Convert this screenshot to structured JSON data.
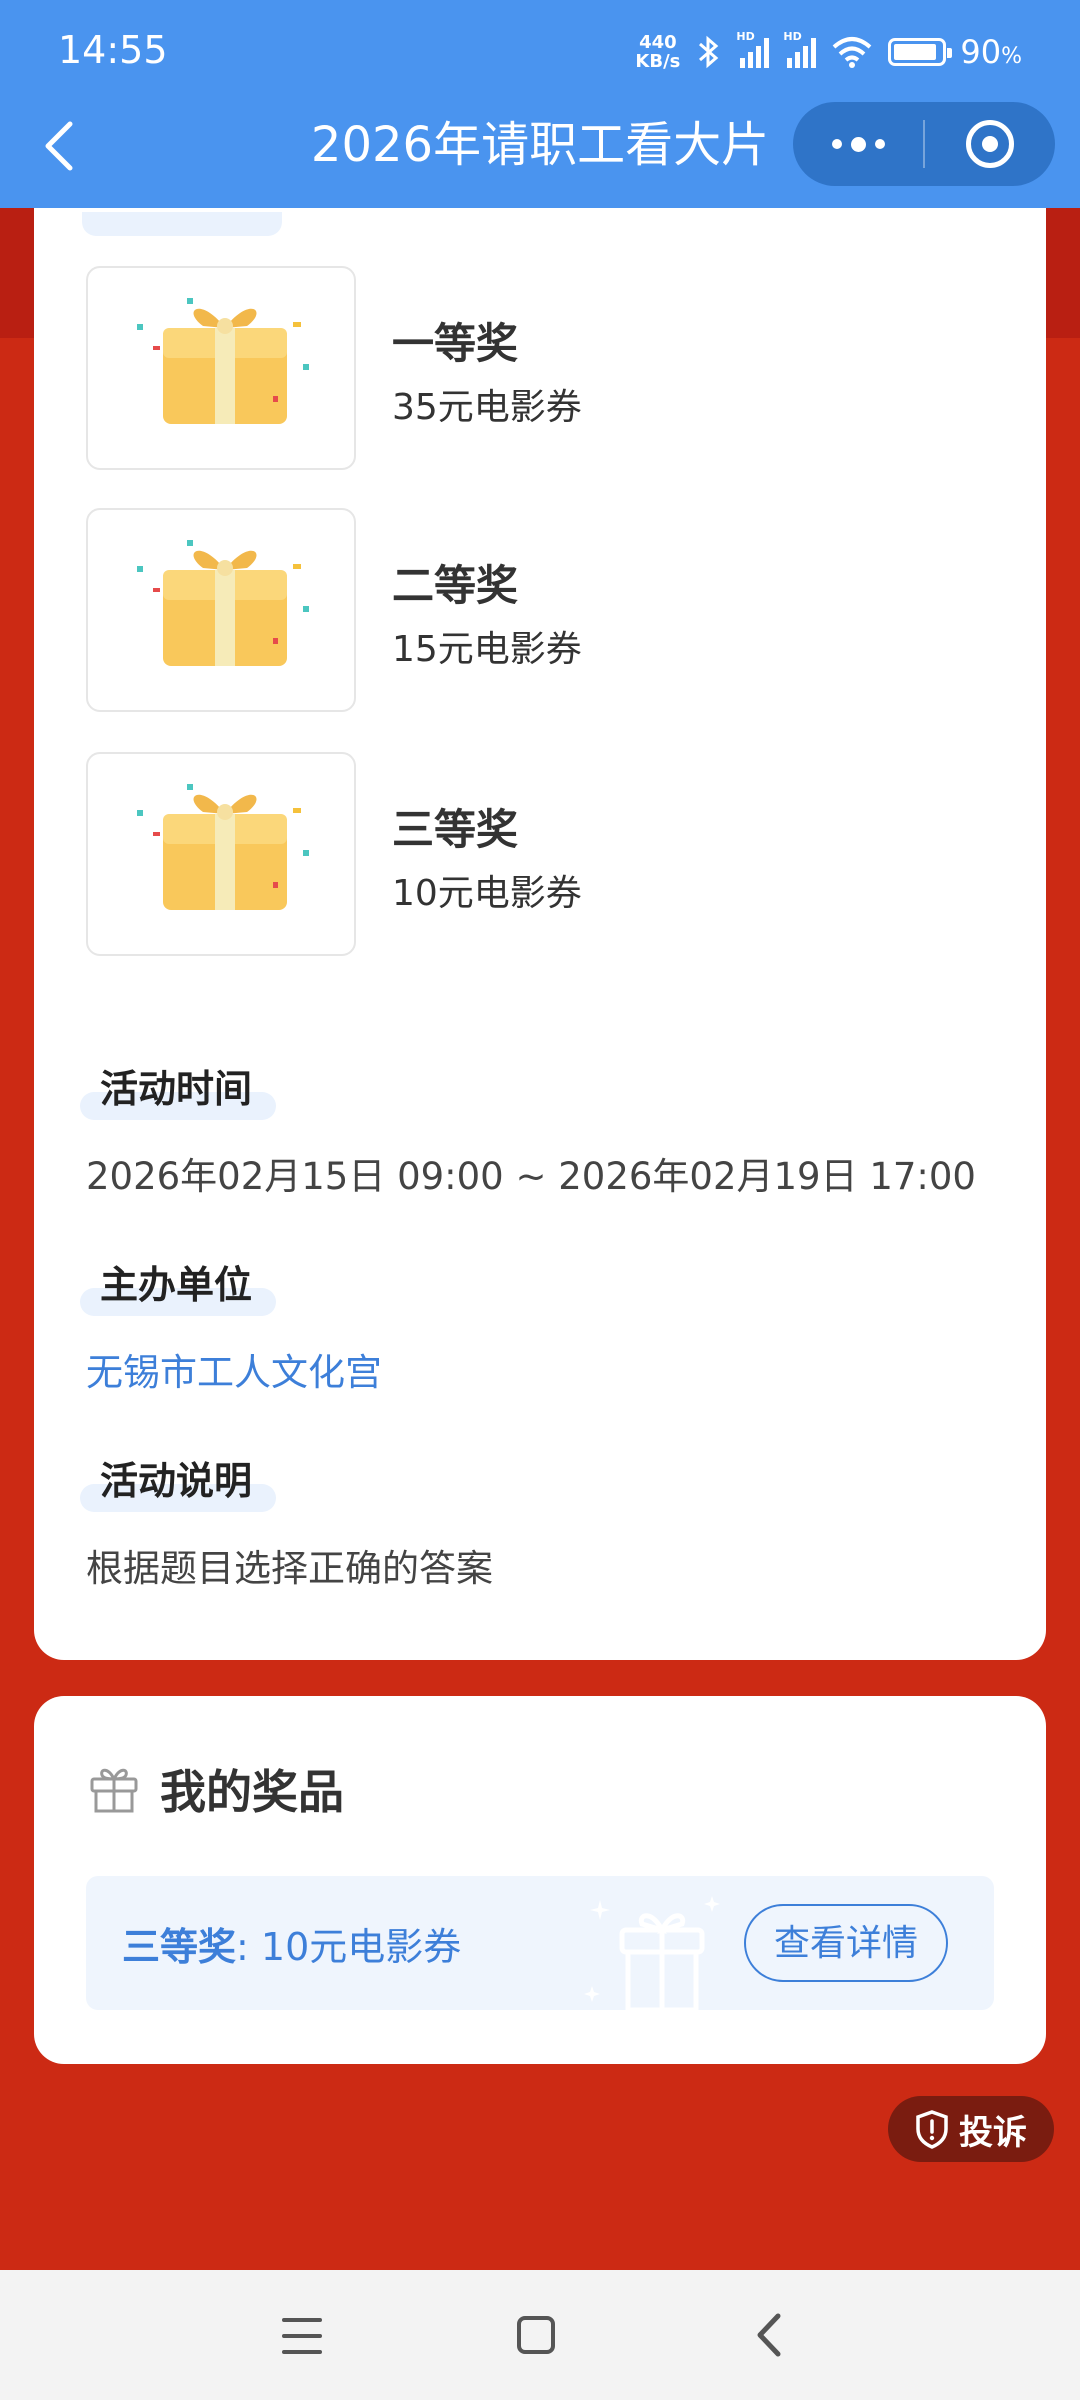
{
  "status_bar": {
    "time": "14:55",
    "net_speed_value": "440",
    "net_speed_unit": "KB/s",
    "battery_percent": "90",
    "battery_unit": "%",
    "battery_level": 0.9
  },
  "header": {
    "title": "2026年请职工看大片",
    "back_icon": "chevron-left-icon",
    "more_icon": "more-dots-icon",
    "close_icon": "target-close-icon",
    "bg_color": "#4a94ef"
  },
  "prizes": [
    {
      "name": "一等奖",
      "desc": "35元电影券",
      "icon": "gift-box-icon"
    },
    {
      "name": "二等奖",
      "desc": "15元电影券",
      "icon": "gift-box-icon"
    },
    {
      "name": "三等奖",
      "desc": "10元电影券",
      "icon": "gift-box-icon"
    }
  ],
  "sections": {
    "time_label": "活动时间",
    "time_value": "2026年02月15日 09:00 ~ 2026年02月19日 17:00",
    "organizer_label": "主办单位",
    "organizer_value": "无锡市工人文化宫",
    "desc_label": "活动说明",
    "desc_value": "根据题目选择正确的答案"
  },
  "my_prizes": {
    "title": "我的奖品",
    "prize_level": "三等奖",
    "prize_desc": ": 10元电影券",
    "detail_button": "查看详情"
  },
  "complain_label": "投诉",
  "colors": {
    "accent": "#3d7fd9",
    "background": "#cc2a14"
  }
}
